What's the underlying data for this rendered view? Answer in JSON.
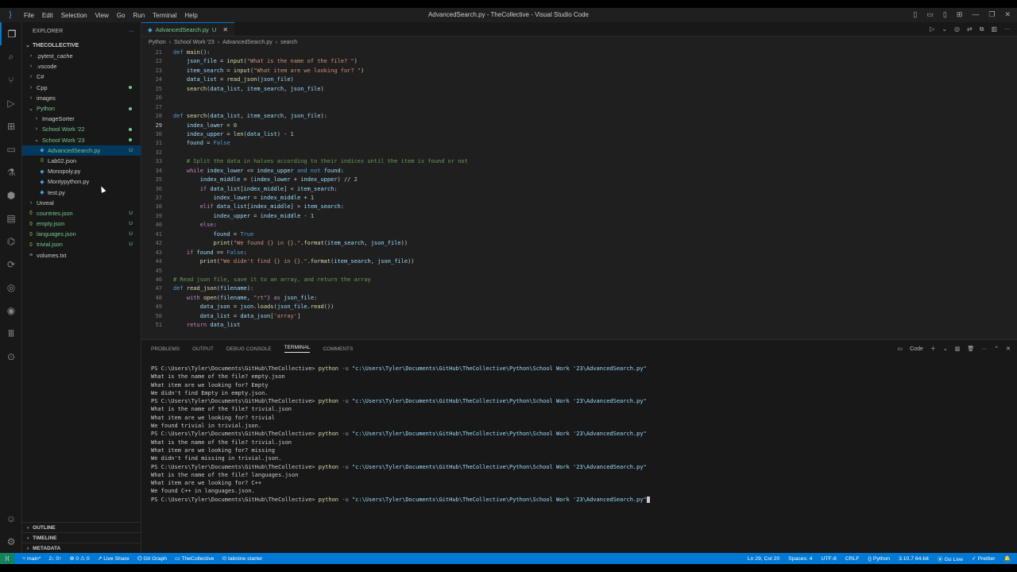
{
  "window": {
    "title": "AdvancedSearch.py - TheCollective - Visual Studio Code",
    "menu": [
      "File",
      "Edit",
      "Selection",
      "View",
      "Go",
      "Run",
      "Terminal",
      "Help"
    ]
  },
  "sidebar": {
    "header": "EXPLORER",
    "root": "THECOLLECTIVE",
    "items": [
      {
        "label": ".pytest_cache",
        "type": "folder",
        "level": 1,
        "color": "#cccccc"
      },
      {
        "label": ".vscode",
        "type": "folder",
        "level": 1,
        "color": "#cccccc"
      },
      {
        "label": "C#",
        "type": "folder",
        "level": 1,
        "color": "#cccccc"
      },
      {
        "label": "Cpp",
        "type": "folder",
        "level": 1,
        "color": "#cccccc",
        "dot": true
      },
      {
        "label": "images",
        "type": "folder",
        "level": 1,
        "color": "#cccccc"
      },
      {
        "label": "Python",
        "type": "folder-open",
        "level": 1,
        "color": "#73c991",
        "dot": true
      },
      {
        "label": "ImageSorter",
        "type": "folder",
        "level": 2,
        "color": "#cccccc"
      },
      {
        "label": "School Work '22",
        "type": "folder",
        "level": 2,
        "color": "#73c991",
        "dot": true
      },
      {
        "label": "School Work '23",
        "type": "folder-open",
        "level": 2,
        "color": "#73c991",
        "dot": true
      },
      {
        "label": "AdvancedSearch.py",
        "type": "py",
        "level": 3,
        "color": "#73c991",
        "badge": "U",
        "selected": true
      },
      {
        "label": "Lab02.json",
        "type": "json",
        "level": 3,
        "color": "#cccccc"
      },
      {
        "label": "Monopoly.py",
        "type": "py",
        "level": 3,
        "color": "#cccccc"
      },
      {
        "label": "Montypython.py",
        "type": "py",
        "level": 3,
        "color": "#cccccc"
      },
      {
        "label": "test.py",
        "type": "py",
        "level": 3,
        "color": "#cccccc"
      },
      {
        "label": "Unreal",
        "type": "folder",
        "level": 1,
        "color": "#cccccc"
      },
      {
        "label": "countries.json",
        "type": "json",
        "level": 1,
        "color": "#73c991",
        "badge": "U"
      },
      {
        "label": "empty.json",
        "type": "json",
        "level": 1,
        "color": "#73c991",
        "badge": "U"
      },
      {
        "label": "languages.json",
        "type": "json",
        "level": 1,
        "color": "#73c991",
        "badge": "U"
      },
      {
        "label": "trivial.json",
        "type": "json",
        "level": 1,
        "color": "#73c991",
        "badge": "U"
      },
      {
        "label": "volumes.txt",
        "type": "txt",
        "level": 1,
        "color": "#cccccc"
      }
    ],
    "sections": [
      "OUTLINE",
      "TIMELINE",
      "METADATA"
    ]
  },
  "editor": {
    "tab": {
      "label": "AdvancedSearch.py",
      "status": "U"
    },
    "breadcrumb": [
      "Python",
      "School Work '23",
      "AdvancedSearch.py",
      "search"
    ],
    "current_line": 29
  },
  "code_lines": [
    {
      "n": "21",
      "html": "<span class='k'>def</span> <span class='f'>main</span>():"
    },
    {
      "n": "22",
      "html": "    <span class='v'>json_file</span> = <span class='f'>input</span>(<span class='s'>\"What is the name of the file? \"</span>)"
    },
    {
      "n": "23",
      "html": "    <span class='v'>item_search</span> = <span class='f'>input</span>(<span class='s'>\"What item are we looking for? \"</span>)"
    },
    {
      "n": "24",
      "html": "    <span class='v'>data_list</span> = <span class='f'>read_json</span>(<span class='v'>json_file</span>)"
    },
    {
      "n": "25",
      "html": "    <span class='f'>search</span>(<span class='v'>data_list</span>, <span class='v'>item_search</span>, <span class='v'>json_file</span>)"
    },
    {
      "n": "26",
      "html": ""
    },
    {
      "n": "27",
      "html": ""
    },
    {
      "n": "28",
      "html": "<span class='k'>def</span> <span class='f'>search</span>(<span class='v'>data_list</span>, <span class='v'>item_search</span>, <span class='v'>json_file</span>):"
    },
    {
      "n": "29",
      "html": "    <span class='v'>index_lower</span> = <span class='n'>0</span>"
    },
    {
      "n": "30",
      "html": "    <span class='v'>index_upper</span> = <span class='f'>len</span>(<span class='v'>data_list</span>) - <span class='n'>1</span>"
    },
    {
      "n": "31",
      "html": "    <span class='v'>found</span> = <span class='k'>False</span>"
    },
    {
      "n": "32",
      "html": ""
    },
    {
      "n": "33",
      "html": "    <span class='cm'># Split the data in halves according to their indices until the item is found or not</span>"
    },
    {
      "n": "34",
      "html": "    <span class='c'>while</span> <span class='v'>index_lower</span> &lt;= <span class='v'>index_upper</span> <span class='k'>and not</span> <span class='v'>found</span>:"
    },
    {
      "n": "35",
      "html": "        <span class='v'>index_middle</span> = (<span class='v'>index_lower</span> + <span class='v'>index_upper</span>) // <span class='n'>2</span>"
    },
    {
      "n": "36",
      "html": "        <span class='c'>if</span> <span class='v'>data_list</span>[<span class='v'>index_middle</span>] &lt; <span class='v'>item_search</span>:"
    },
    {
      "n": "37",
      "html": "            <span class='v'>index_lower</span> = <span class='v'>index_middle</span> + <span class='n'>1</span>"
    },
    {
      "n": "38",
      "html": "        <span class='c'>elif</span> <span class='v'>data_list</span>[<span class='v'>index_middle</span>] &gt; <span class='v'>item_search</span>:"
    },
    {
      "n": "39",
      "html": "            <span class='v'>index_upper</span> = <span class='v'>index_middle</span> - <span class='n'>1</span>"
    },
    {
      "n": "40",
      "html": "        <span class='c'>else</span>:"
    },
    {
      "n": "41",
      "html": "            <span class='v'>found</span> = <span class='k'>True</span>"
    },
    {
      "n": "42",
      "html": "            <span class='f'>print</span>(<span class='s'>\"We found {} in {}.\"</span>.<span class='f'>format</span>(<span class='v'>item_search</span>, <span class='v'>json_file</span>))"
    },
    {
      "n": "43",
      "html": "    <span class='c'>if</span> <span class='v'>found</span> == <span class='k'>False</span>:"
    },
    {
      "n": "44",
      "html": "        <span class='f'>print</span>(<span class='s'>\"We didn't find {} in {}.\"</span>.<span class='f'>format</span>(<span class='v'>item_search</span>, <span class='v'>json_file</span>))"
    },
    {
      "n": "45",
      "html": ""
    },
    {
      "n": "46",
      "html": "<span class='cm'># Read json file, save it to an array, and return the array</span>"
    },
    {
      "n": "47",
      "html": "<span class='k'>def</span> <span class='f'>read_json</span>(<span class='v'>filename</span>):"
    },
    {
      "n": "48",
      "html": "    <span class='c'>with</span> <span class='f'>open</span>(<span class='v'>filename</span>, <span class='s'>\"rt\"</span>) <span class='c'>as</span> <span class='v'>json_file</span>:"
    },
    {
      "n": "49",
      "html": "        <span class='v'>data_json</span> = <span class='v'>json</span>.<span class='f'>loads</span>(<span class='v'>json_file</span>.<span class='f'>read</span>())"
    },
    {
      "n": "50",
      "html": "        <span class='v'>data_list</span> = <span class='v'>data_json</span>[<span class='s'>'array'</span>]"
    },
    {
      "n": "51",
      "html": "    <span class='c'>return</span> <span class='v'>data_list</span>"
    }
  ],
  "panel": {
    "tabs": [
      "PROBLEMS",
      "OUTPUT",
      "DEBUG CONSOLE",
      "TERMINAL",
      "COMMENTS"
    ],
    "active_tab": "TERMINAL",
    "terminal_name": "Code"
  },
  "terminal": {
    "prompt": "PS C:\\Users\\Tyler\\Documents\\GitHub\\TheCollective>",
    "command": "python",
    "flag": "-u",
    "path": "\"c:\\Users\\Tyler\\Documents\\GitHub\\TheCollective\\Python\\School Work '23\\AdvancedSearch.py\"",
    "lines": [
      {
        "kind": "cmd"
      },
      {
        "kind": "out",
        "text": "What is the name of the file? empty.json"
      },
      {
        "kind": "out",
        "text": "What item are we looking for? Empty"
      },
      {
        "kind": "out",
        "text": "We didn't find Empty in empty.json."
      },
      {
        "kind": "cmd"
      },
      {
        "kind": "out",
        "text": "What is the name of the file? trivial.json"
      },
      {
        "kind": "out",
        "text": "What item are we looking for? trivial"
      },
      {
        "kind": "out",
        "text": "We found trivial in trivial.json."
      },
      {
        "kind": "cmd"
      },
      {
        "kind": "out",
        "text": "What is the name of the file? trivial.json"
      },
      {
        "kind": "out",
        "text": "What item are we looking for? missing"
      },
      {
        "kind": "out",
        "text": "We didn't find missing in trivial.json."
      },
      {
        "kind": "cmd"
      },
      {
        "kind": "out",
        "text": "What is the name of the file? languages.json"
      },
      {
        "kind": "out",
        "text": "What item are we looking for? C++"
      },
      {
        "kind": "out",
        "text": "We found C++ in languages.json."
      },
      {
        "kind": "cmd",
        "cursor": true
      }
    ]
  },
  "statusbar": {
    "branch": "main*",
    "sync": "2↓ 0↑",
    "problems": "⊗ 0 ⚠ 0",
    "liveshare": "Live Share",
    "gitgraph": "Git Graph",
    "project": "TheCollective",
    "tabnine": "tabnine starter",
    "position": "Ln 29, Col 20",
    "spaces": "Spaces: 4",
    "encoding": "UTF-8",
    "eol": "CRLF",
    "language": "Python",
    "interpreter": "3.10.7 64-bit",
    "golive": "Go Live",
    "prettier": "Prettier"
  },
  "colors": {
    "accent": "#0078d4",
    "untracked": "#73c991",
    "statusbar": "#0078d4"
  }
}
